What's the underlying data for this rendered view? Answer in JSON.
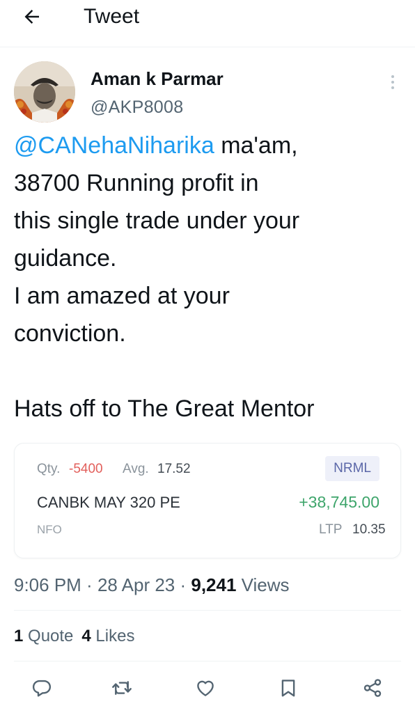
{
  "header": {
    "title": "Tweet",
    "back_icon": "arrow-left-icon"
  },
  "author": {
    "name": "Aman k Parmar",
    "handle": "@AKP8008",
    "avatar_icon": "profile-photo"
  },
  "tweet": {
    "mention": "@CANehaNiharika",
    "line1_rest": " ma'am,",
    "line2": "38700 Running profit in",
    "line3": "this single trade under your",
    "line4": "guidance.",
    "line5": "I am amazed at your",
    "line6": "conviction.",
    "line8": "Hats off to The Great Mentor"
  },
  "position_card": {
    "qty_label": "Qty.",
    "qty_value": "-5400",
    "avg_label": "Avg.",
    "avg_value": "17.52",
    "product": "NRML",
    "symbol": "CANBK MAY 320 PE",
    "pnl": "+38,745.00",
    "exchange": "NFO",
    "ltp_label": "LTP",
    "ltp_value": "10.35",
    "colors": {
      "negative": "#e25f5b",
      "positive": "#3ea56b",
      "badge_bg": "#eef0f9",
      "badge_fg": "#5b67a8"
    }
  },
  "meta": {
    "time": "9:06 PM",
    "sep1": " · ",
    "date": "28 Apr 23",
    "sep2": " · ",
    "views_count": "9,241",
    "views_label": " Views"
  },
  "stats": {
    "quotes_count": "1",
    "quotes_label": " Quote",
    "likes_count": "4",
    "likes_label": " Likes"
  },
  "actions": [
    "reply-icon",
    "retweet-icon",
    "like-icon",
    "bookmark-icon",
    "share-icon"
  ],
  "colors": {
    "link": "#1d9bf0",
    "text": "#0f1419",
    "secondary": "#536471"
  }
}
